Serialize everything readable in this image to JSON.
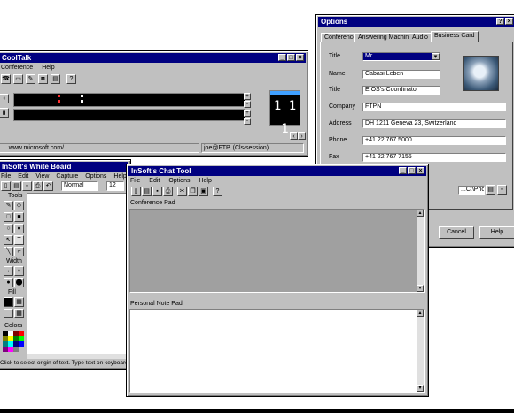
{
  "desktop": {
    "background": "#ffffff",
    "title_color": "#000080"
  },
  "cooltalk": {
    "title": "CoolTalk",
    "menu": [
      "Conference",
      "Help"
    ],
    "status_left": "... www.microsoft.com/...",
    "status_right": "joe@FTP.  (Cls/session)",
    "display_digits": "1 1 1"
  },
  "whiteboard": {
    "title": "InSoft's White Board",
    "menu": [
      "File",
      "Edit",
      "View",
      "Capture",
      "Options",
      "Help"
    ],
    "font_value": "Normal",
    "font_size": "12",
    "tools_label": "Tools",
    "width_label": "Width",
    "fill_label": "Fill",
    "colors_label": "Colors",
    "status": "Click to select origin of text. Type text on keyboard."
  },
  "chat": {
    "title": "InSoft's Chat Tool",
    "menu": [
      "File",
      "Edit",
      "Options",
      "Help"
    ],
    "conference_label": "Conference Pad",
    "personal_label": "Personal Note Pad"
  },
  "options": {
    "title": "Options",
    "tabs": [
      "Conference",
      "Answering Machine",
      "Audio",
      "Business Card"
    ],
    "active_tab": "Business Card",
    "fields": [
      {
        "label": "Title",
        "value": "Mr."
      },
      {
        "label": "Name",
        "value": "Cabasi Leben"
      },
      {
        "label": "Title",
        "value": "EIOS's Coordinator"
      },
      {
        "label": "Company",
        "value": "FTPN"
      },
      {
        "label": "Address",
        "value": "DH 1211 Geneva 23, Switzerland"
      },
      {
        "label": "Phone",
        "value": "+41 22 767 5000"
      },
      {
        "label": "Fax",
        "value": "+41 22 767 7155"
      }
    ],
    "card_path": "...C:\\Photo\\bot.bmp",
    "cancel_label": "Cancel",
    "help_label": "Help"
  }
}
